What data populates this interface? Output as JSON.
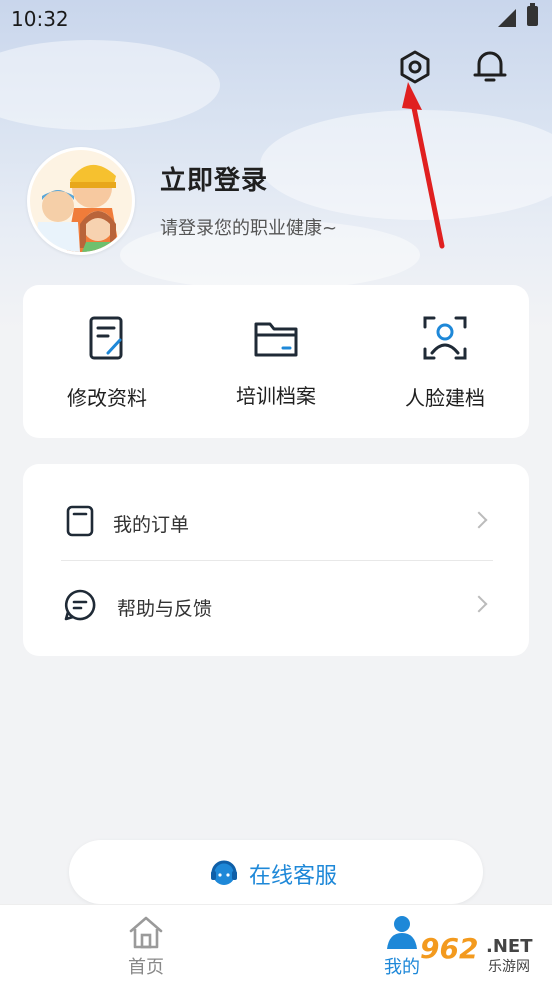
{
  "status_bar": {
    "time": "10:32"
  },
  "header": {
    "icons": {
      "settings": "gear-hexagon-icon",
      "notification": "bell-icon"
    }
  },
  "profile": {
    "title": "立即登录",
    "subtitle": "请登录您的职业健康~"
  },
  "quick_actions": [
    {
      "label": "修改资料",
      "icon": "edit-document-icon"
    },
    {
      "label": "培训档案",
      "icon": "folder-icon"
    },
    {
      "label": "人脸建档",
      "icon": "face-scan-icon"
    }
  ],
  "menu": [
    {
      "label": "我的订单",
      "icon": "order-icon"
    },
    {
      "label": "帮助与反馈",
      "icon": "feedback-icon"
    }
  ],
  "service": {
    "label": "在线客服",
    "icon": "headset-icon"
  },
  "tabbar": [
    {
      "label": "首页",
      "icon": "home-icon",
      "active": false
    },
    {
      "label": "我的",
      "icon": "user-icon",
      "active": true
    }
  ],
  "watermark": {
    "brand": "962",
    "net": ".NET",
    "text": "乐游网"
  },
  "colors": {
    "accent": "#1e88d8",
    "watermark": "#f39a1e",
    "arrow": "#e02020"
  }
}
